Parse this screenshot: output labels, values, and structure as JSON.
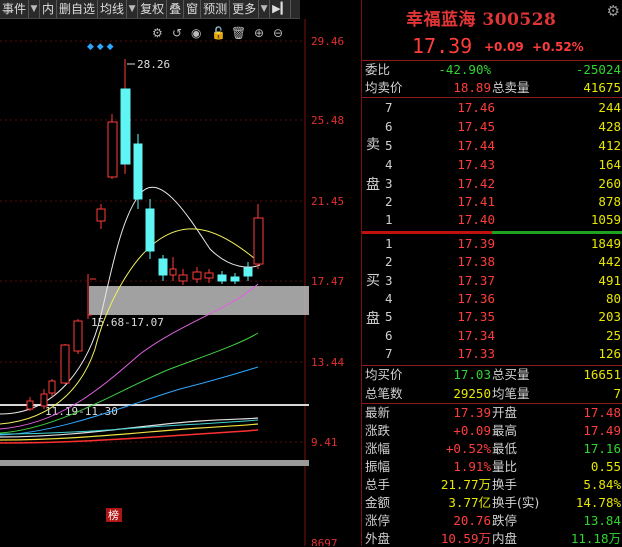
{
  "toolbar": {
    "items": [
      "事件",
      "内",
      "删自选",
      "均线",
      "复权",
      "叠",
      "窗",
      "预测",
      "更多"
    ],
    "settings_icon": "gear-icon"
  },
  "chart": {
    "price_axis": [
      "29.46",
      "25.48",
      "21.45",
      "17.47",
      "13.44",
      "9.41",
      "8697"
    ],
    "peak_label": "28.26",
    "range_label_high": "15.68-17.07",
    "range_label_low": "11.19-11.30",
    "badge": "榜"
  },
  "quote": {
    "title": "幸福蓝海 300528",
    "price": "17.39",
    "change": "+0.09",
    "change_pct": "+0.52%",
    "weibi_label": "委比",
    "weibi_value": "-42.90%",
    "weicha_value": "-25024",
    "avg_sell_label": "均卖价",
    "avg_sell": "18.89",
    "total_sell_label": "总卖量",
    "total_sell": "41675",
    "sell_side_1": "卖",
    "sell_side_2": "盘",
    "buy_side_1": "买",
    "buy_side_2": "盘",
    "sells": [
      {
        "lvl": "7",
        "price": "17.46",
        "vol": "244"
      },
      {
        "lvl": "6",
        "price": "17.45",
        "vol": "428"
      },
      {
        "lvl": "5",
        "price": "17.44",
        "vol": "412"
      },
      {
        "lvl": "4",
        "price": "17.43",
        "vol": "164"
      },
      {
        "lvl": "3",
        "price": "17.42",
        "vol": "260"
      },
      {
        "lvl": "2",
        "price": "17.41",
        "vol": "878"
      },
      {
        "lvl": "1",
        "price": "17.40",
        "vol": "1059"
      }
    ],
    "buys": [
      {
        "lvl": "1",
        "price": "17.39",
        "vol": "1849"
      },
      {
        "lvl": "2",
        "price": "17.38",
        "vol": "442"
      },
      {
        "lvl": "3",
        "price": "17.37",
        "vol": "491"
      },
      {
        "lvl": "4",
        "price": "17.36",
        "vol": "80"
      },
      {
        "lvl": "5",
        "price": "17.35",
        "vol": "203"
      },
      {
        "lvl": "6",
        "price": "17.34",
        "vol": "25"
      },
      {
        "lvl": "7",
        "price": "17.33",
        "vol": "126"
      }
    ],
    "avg_buy_label": "均买价",
    "avg_buy": "17.03",
    "total_buy_label": "总买量",
    "total_buy": "16651",
    "total_trades_label": "总笔数",
    "total_trades": "29250",
    "avg_lot_label": "均笔量",
    "avg_lot": "7",
    "stats": [
      {
        "l1": "最新",
        "v1": "17.39",
        "c1": "red",
        "l2": "开盘",
        "v2": "17.48",
        "c2": "red"
      },
      {
        "l1": "涨跌",
        "v1": "+0.09",
        "c1": "red",
        "l2": "最高",
        "v2": "17.49",
        "c2": "red"
      },
      {
        "l1": "涨幅",
        "v1": "+0.52%",
        "c1": "red",
        "l2": "最低",
        "v2": "17.16",
        "c2": "green"
      },
      {
        "l1": "振幅",
        "v1": "1.91%",
        "c1": "red",
        "l2": "量比",
        "v2": "0.55",
        "c2": "yellow"
      },
      {
        "l1": "总手",
        "v1": "21.77万",
        "c1": "yellow",
        "l2": "换手",
        "v2": "5.84%",
        "c2": "yellow"
      },
      {
        "l1": "金额",
        "v1": "3.77亿",
        "c1": "yellow",
        "l2": "换手(实)",
        "v2": "14.78%",
        "c2": "yellow"
      },
      {
        "l1": "涨停",
        "v1": "20.76",
        "c1": "red",
        "l2": "跌停",
        "v2": "13.84",
        "c2": "green"
      },
      {
        "l1": "外盘",
        "v1": "10.59万",
        "c1": "red",
        "l2": "内盘",
        "v2": "11.18万",
        "c2": "green"
      }
    ]
  },
  "colors": {
    "up": "#ff3d3d",
    "down": "#2fd52f",
    "vol": "#e6e600",
    "bg": "#000000",
    "cyan_candle": "#5ff5f5"
  }
}
